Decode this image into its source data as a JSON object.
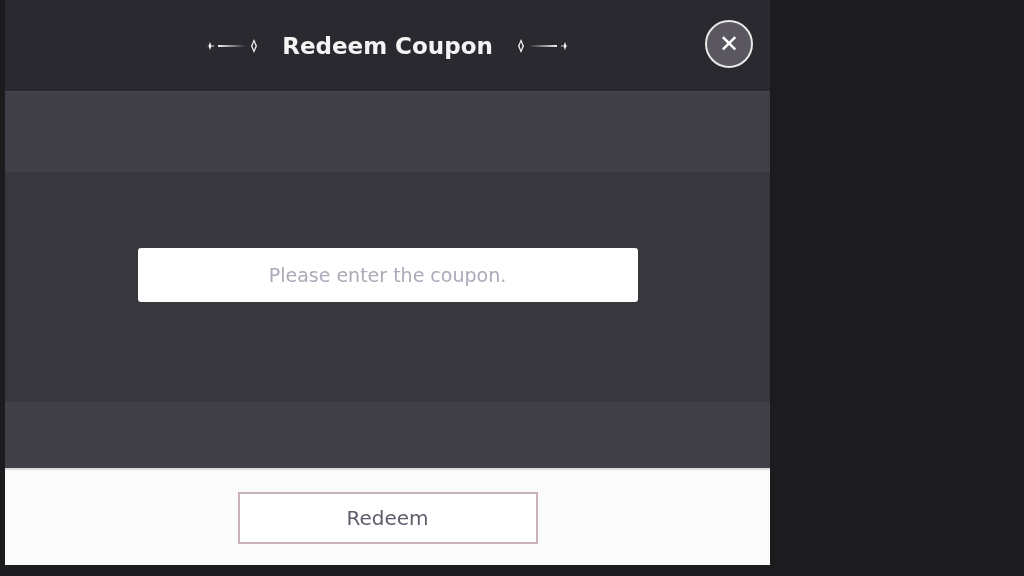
{
  "dialog": {
    "title": "Redeem Coupon",
    "close_label": "✕",
    "coupon_field": {
      "placeholder": "Please enter the coupon."
    },
    "buttons": [
      {
        "label": "Redeem"
      }
    ]
  }
}
